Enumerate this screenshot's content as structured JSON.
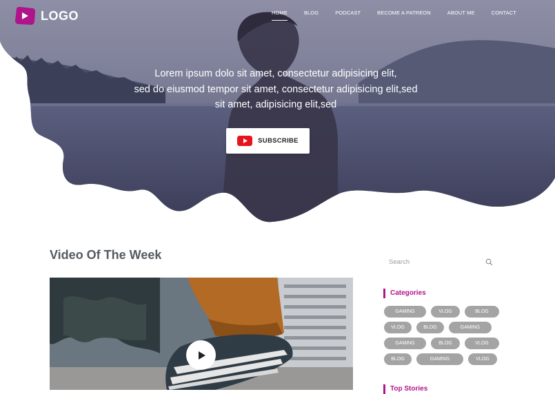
{
  "brand": {
    "name": "LOGO",
    "icon": "play-logo-icon",
    "accent": "#b0148a"
  },
  "nav": {
    "items": [
      {
        "label": "HOME",
        "active": true
      },
      {
        "label": "BLOG"
      },
      {
        "label": "PODCAST"
      },
      {
        "label": "BECOME A PATREON"
      },
      {
        "label": "ABOUT ME"
      },
      {
        "label": "CONTACT"
      }
    ]
  },
  "hero": {
    "lines": [
      "Lorem ipsum dolo sit amet, consectetur adipisicing elit,",
      "sed do eiusmod tempor sit amet, consectetur adipisicing elit,sed",
      "sit amet, adipisicing elit,sed"
    ],
    "subscribe_label": "SUBSCRIBE",
    "subscribe_icon": "youtube-icon"
  },
  "main": {
    "video_title": "Video Of The Week",
    "video_icon": "play-icon"
  },
  "sidebar": {
    "search_placeholder": "Search",
    "search_icon": "search-icon",
    "categories_heading": "Categories",
    "tags": [
      [
        "GAMING",
        "VLOG",
        "BLOG"
      ],
      [
        "VLOG",
        "BLOG",
        "GAMING"
      ],
      [
        "GAMING",
        "BLOG",
        "VLOG"
      ],
      [
        "BLOG",
        "GAMING",
        "VLOG"
      ]
    ],
    "top_stories_heading": "Top Stories"
  }
}
